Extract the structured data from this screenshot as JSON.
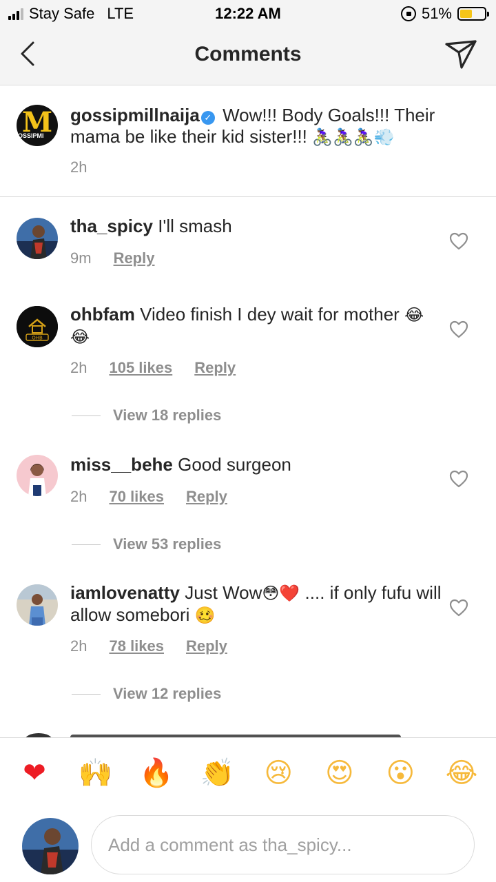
{
  "status_bar": {
    "carrier": "Stay Safe",
    "network": "LTE",
    "time": "12:22 AM",
    "battery": "51%",
    "battery_level": 0.51,
    "battery_color": "#f5c518"
  },
  "header": {
    "title": "Comments",
    "back_icon": "chevron-left-icon",
    "send_icon": "paper-plane-icon"
  },
  "caption": {
    "username": "gossipmillnaija",
    "verified": true,
    "text": "Wow!!! Body Goals!!! Their mama be like their kid sister!!!",
    "emojis": "🚴🏾‍♀️🚴🏾‍♀️🚴🏾‍♀️💨",
    "time": "2h",
    "avatar_letter": "M",
    "avatar_strip": "OSSIPMI"
  },
  "comments": [
    {
      "username": "tha_spicy",
      "text": "I'll smash",
      "emojis": "",
      "time": "9m",
      "likes": "",
      "reply": "Reply",
      "view_replies": ""
    },
    {
      "username": "ohbfam",
      "text": "Video finish I dey wait for mother",
      "emojis": "😂😂",
      "time": "2h",
      "likes": "105 likes",
      "reply": "Reply",
      "view_replies": "View 18 replies",
      "avatar_label": "OHB"
    },
    {
      "username": "miss__behe",
      "text": "Good surgeon",
      "emojis": "",
      "time": "2h",
      "likes": "70 likes",
      "reply": "Reply",
      "view_replies": "View 53 replies"
    },
    {
      "username": "iamlovenatty",
      "text_a": "Just Wow",
      "emoji_a": "😳❤️",
      "text_b": ".... if only fufu will allow somebori",
      "emoji_b": "🥴",
      "time": "2h",
      "likes": "78 likes",
      "reply": "Reply",
      "view_replies": "View 12 replies"
    }
  ],
  "reactions": [
    {
      "name": "red-heart-icon",
      "glyph": "❤"
    },
    {
      "name": "raising-hands-icon",
      "glyph": "🙌"
    },
    {
      "name": "fire-icon",
      "glyph": "🔥"
    },
    {
      "name": "clapping-hands-icon",
      "glyph": "👏"
    },
    {
      "name": "crying-face-icon",
      "glyph": "😢"
    },
    {
      "name": "heart-eyes-icon",
      "glyph": "😍"
    },
    {
      "name": "surprised-face-icon",
      "glyph": "😮"
    },
    {
      "name": "tears-of-joy-icon",
      "glyph": "😂"
    }
  ],
  "composer": {
    "placeholder": "Add a comment as tha_spicy..."
  }
}
